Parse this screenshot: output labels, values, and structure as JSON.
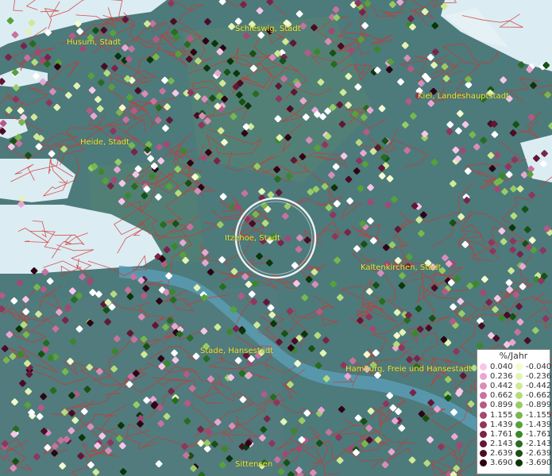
{
  "labels": {
    "schleswig": "Schleswig, Stadt",
    "husum": "Husum, Stadt",
    "kiel": "Kiel, Landeshauptstadt",
    "heide": "Heide, Stadt",
    "itzehoe": "Itzehoe, Stadt",
    "kaltenkirchen": "Kaltenkirchen, Stadt",
    "stade": "Stade, Hansestadt",
    "hamburg": "Hamburg, Freie und Hansestadt",
    "sittensen": "Sittensen"
  },
  "legend": {
    "unit": "%/Jahr",
    "positive": [
      "0.040",
      "0.236",
      "0.442",
      "0.662",
      "0.899",
      "1.155",
      "1.439",
      "1.761",
      "2.143",
      "2.639",
      "3.690"
    ],
    "negative": [
      "-0.040",
      "-0.236",
      "-0.442",
      "-0.662",
      "-0.899",
      "-1.155",
      "-1.439",
      "-1.761",
      "-2.143",
      "-2.639",
      "-3.690"
    ],
    "positive_colors": [
      "#f7c6e6",
      "#eaa6d2",
      "#d98dba",
      "#c7729f",
      "#b55a86",
      "#a34872",
      "#8e365e",
      "#78254a",
      "#621736",
      "#4a0c24",
      "#2e0414"
    ],
    "negative_colors": [
      "#f4fbd0",
      "#e3f3b3",
      "#cfe995",
      "#b5dc7c",
      "#97cc64",
      "#77b84c",
      "#57a13a",
      "#3c872b",
      "#276c1f",
      "#175113",
      "#0a3609"
    ]
  },
  "colors": {
    "land": "#4d7a7b",
    "water": "#dcecf3",
    "border": "#d2362f",
    "label": "#f2ea3a"
  }
}
